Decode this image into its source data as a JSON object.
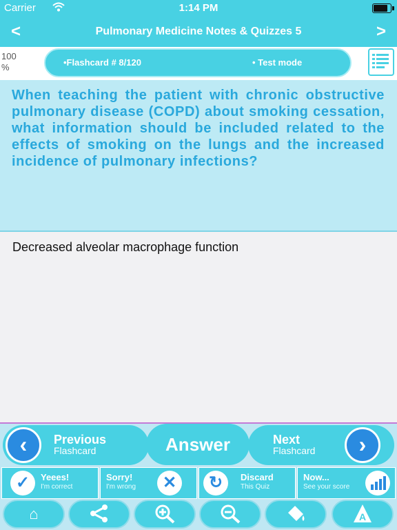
{
  "status_bar": {
    "carrier": "Carrier",
    "time": "1:14 PM"
  },
  "nav": {
    "title": "Pulmonary Medicine Notes & Quizzes 5",
    "back": "<",
    "forward": ">"
  },
  "info": {
    "progress": "100 %",
    "flashcard": "•Flashcard #  8/120",
    "mode": "• Test mode"
  },
  "question": "When teaching the patient with chronic obstructive pulmonary disease (COPD) about smoking cessation, what information should be included related to the effects of smoking on the lungs and the increased incidence of pulmonary infections?",
  "answer": "Decreased alveolar macrophage function",
  "controls": {
    "previous": {
      "main": "Previous",
      "sub": "Flashcard"
    },
    "answer_button": "Answer",
    "next": {
      "main": "Next",
      "sub": "Flashcard"
    },
    "yes": {
      "main": "Yeees!",
      "sub": "I'm correct"
    },
    "sorry": {
      "main": "Sorry!",
      "sub": "I'm wrong"
    },
    "discard": {
      "main": "Discard",
      "sub": "This Quiz"
    },
    "now": {
      "main": "Now...",
      "sub": "See your score"
    }
  },
  "toolbar": {
    "icons": [
      "home-icon",
      "share-icon",
      "zoom-in-icon",
      "zoom-out-icon",
      "paint-bucket-icon",
      "font-icon"
    ]
  },
  "colors": {
    "accent": "#48d1e3",
    "question_bg": "#bdeaf5",
    "question_text": "#29a8dc",
    "button_blue": "#2a8be0"
  }
}
